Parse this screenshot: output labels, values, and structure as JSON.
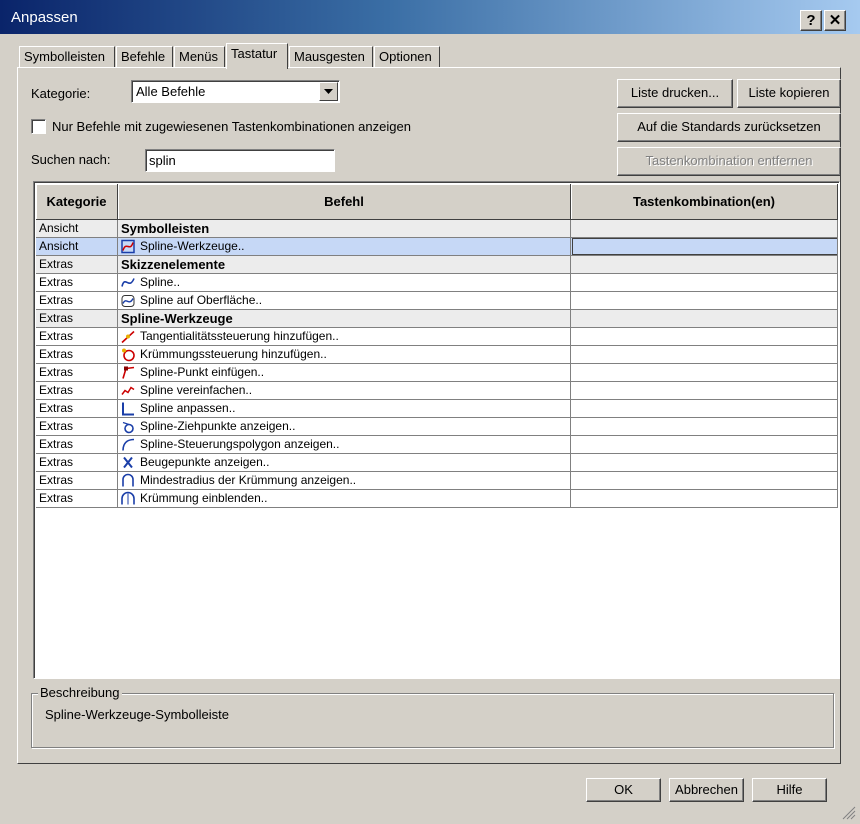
{
  "window": {
    "title": "Anpassen",
    "help_label": "?",
    "close_label": "✕"
  },
  "tabs": [
    {
      "label": "Symbolleisten"
    },
    {
      "label": "Befehle"
    },
    {
      "label": "Menüs"
    },
    {
      "label": "Tastatur",
      "active": true
    },
    {
      "label": "Mausgesten"
    },
    {
      "label": "Optionen"
    }
  ],
  "filters": {
    "category_label": "Kategorie:",
    "category_value": "Alle Befehle",
    "only_assigned_label": "Nur Befehle mit zugewiesenen Tastenkombinationen anzeigen",
    "only_assigned_checked": false,
    "search_label": "Suchen nach:",
    "search_value": "splin"
  },
  "buttons": {
    "print_list": "Liste drucken...",
    "copy_list": "Liste kopieren",
    "reset_defaults": "Auf die Standards zurücksetzen",
    "remove_shortcut": "Tastenkombination entfernen"
  },
  "table": {
    "headers": [
      "Kategorie",
      "Befehl",
      "Tastenkombination(en)"
    ],
    "rows": [
      {
        "category": "Ansicht",
        "command": "Symbolleisten",
        "shortcut": "",
        "group": true
      },
      {
        "category": "Ansicht",
        "command": "Spline-Werkzeuge..",
        "shortcut": "",
        "icon": "spline-tools-icon",
        "selected": true
      },
      {
        "category": "Extras",
        "command": "Skizzenelemente",
        "shortcut": "",
        "group": true
      },
      {
        "category": "Extras",
        "command": "Spline..",
        "shortcut": "",
        "icon": "spline-icon"
      },
      {
        "category": "Extras",
        "command": "Spline auf Oberfläche..",
        "shortcut": "",
        "icon": "spline-on-surface-icon"
      },
      {
        "category": "Extras",
        "command": "Spline-Werkzeuge",
        "shortcut": "",
        "group": true
      },
      {
        "category": "Extras",
        "command": "Tangentialitätssteuerung hinzufügen..",
        "shortcut": "",
        "icon": "add-tangency-control-icon"
      },
      {
        "category": "Extras",
        "command": "Krümmungssteuerung hinzufügen..",
        "shortcut": "",
        "icon": "add-curvature-control-icon"
      },
      {
        "category": "Extras",
        "command": "Spline-Punkt einfügen..",
        "shortcut": "",
        "icon": "insert-spline-point-icon"
      },
      {
        "category": "Extras",
        "command": "Spline vereinfachen..",
        "shortcut": "",
        "icon": "simplify-spline-icon"
      },
      {
        "category": "Extras",
        "command": "Spline anpassen..",
        "shortcut": "",
        "icon": "fit-spline-icon"
      },
      {
        "category": "Extras",
        "command": "Spline-Ziehpunkte anzeigen..",
        "shortcut": "",
        "icon": "show-spline-handles-icon"
      },
      {
        "category": "Extras",
        "command": "Spline-Steuerungspolygon anzeigen..",
        "shortcut": "",
        "icon": "show-control-polygon-icon"
      },
      {
        "category": "Extras",
        "command": "Beugepunkte anzeigen..",
        "shortcut": "",
        "icon": "show-inflection-points-icon"
      },
      {
        "category": "Extras",
        "command": "Mindestradius der Krümmung anzeigen..",
        "shortcut": "",
        "icon": "minimum-radius-icon"
      },
      {
        "category": "Extras",
        "command": "Krümmung einblenden..",
        "shortcut": "",
        "icon": "show-curvature-icon"
      }
    ]
  },
  "description": {
    "label": "Beschreibung",
    "text": "Spline-Werkzeuge-Symbolleiste"
  },
  "footer": {
    "ok": "OK",
    "cancel": "Abbrechen",
    "help": "Hilfe"
  },
  "colors": {
    "title_start": "#0a246a",
    "title_end": "#a6caf0",
    "selection": "#c6d8f6",
    "face": "#d4d0c8"
  }
}
